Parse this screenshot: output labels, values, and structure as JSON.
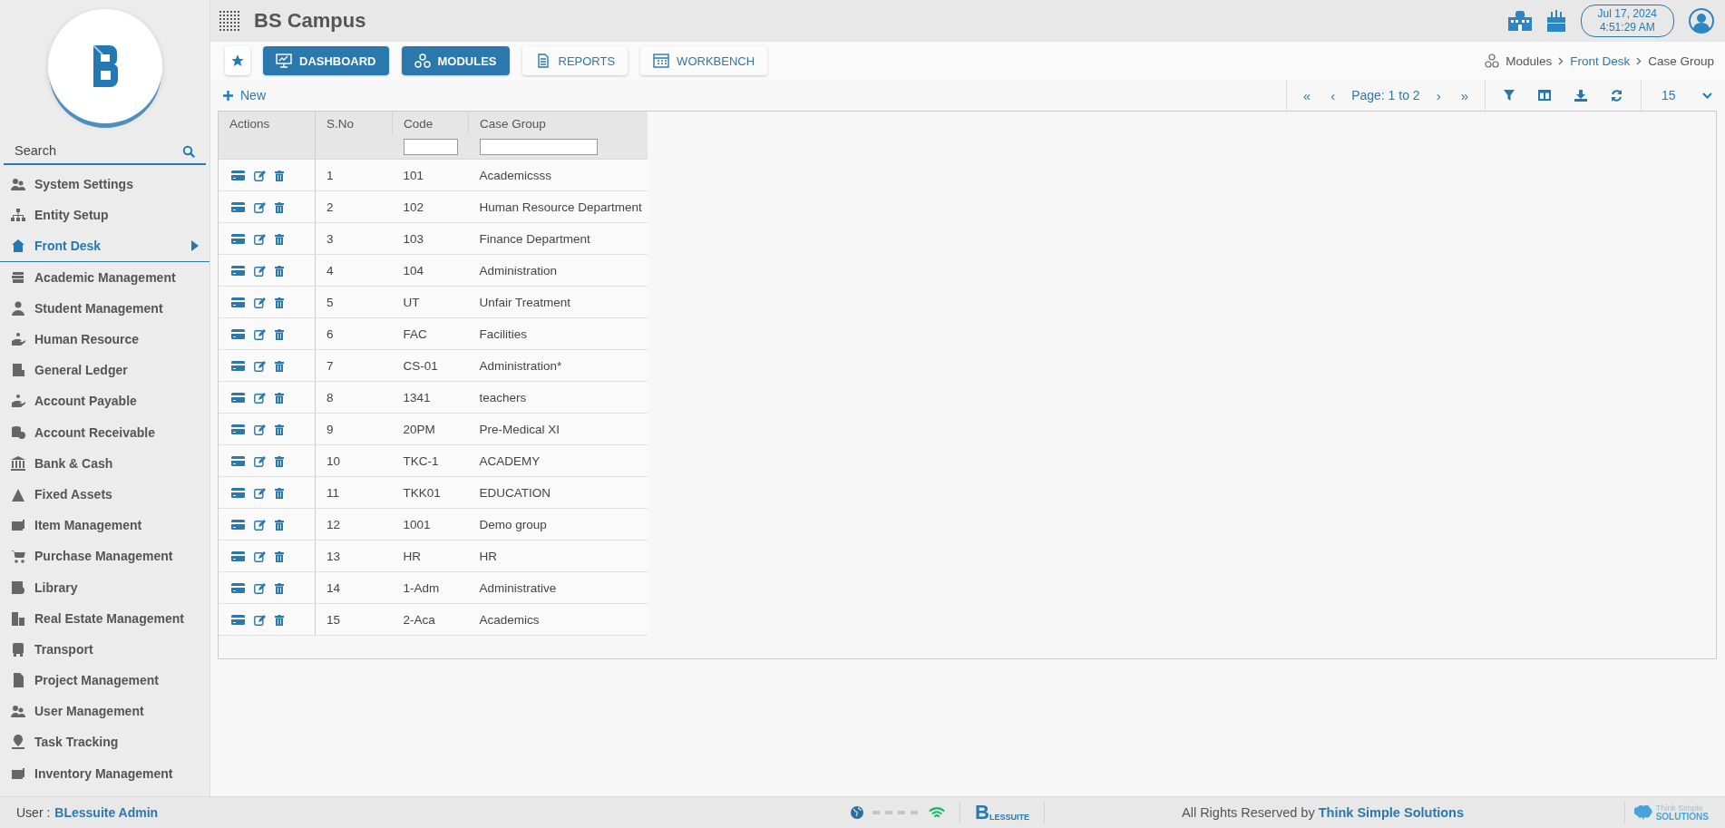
{
  "app": {
    "title": "BS Campus"
  },
  "header": {
    "date": "Jul 17, 2024",
    "time": "4:51:29 AM"
  },
  "sidebar": {
    "search": {
      "placeholder": "Search"
    },
    "items": [
      {
        "label": "System Settings",
        "selected": false
      },
      {
        "label": "Entity Setup",
        "selected": false
      },
      {
        "label": "Front Desk",
        "selected": true
      },
      {
        "label": "Academic Management",
        "selected": false
      },
      {
        "label": "Student Management",
        "selected": false
      },
      {
        "label": "Human Resource",
        "selected": false
      },
      {
        "label": "General Ledger",
        "selected": false
      },
      {
        "label": "Account Payable",
        "selected": false
      },
      {
        "label": "Account Receivable",
        "selected": false
      },
      {
        "label": "Bank & Cash",
        "selected": false
      },
      {
        "label": "Fixed Assets",
        "selected": false
      },
      {
        "label": "Item Management",
        "selected": false
      },
      {
        "label": "Purchase Management",
        "selected": false
      },
      {
        "label": "Library",
        "selected": false
      },
      {
        "label": "Real Estate Management",
        "selected": false
      },
      {
        "label": "Transport",
        "selected": false
      },
      {
        "label": "Project Management",
        "selected": false
      },
      {
        "label": "User Management",
        "selected": false
      },
      {
        "label": "Task Tracking",
        "selected": false
      },
      {
        "label": "Inventory Management",
        "selected": false
      }
    ]
  },
  "nav_buttons": [
    {
      "label": "DASHBOARD",
      "highlighted": true
    },
    {
      "label": "MODULES",
      "highlighted": true
    },
    {
      "label": "REPORTS",
      "highlighted": false
    },
    {
      "label": "WORKBENCH",
      "highlighted": false
    }
  ],
  "breadcrumb": [
    {
      "label": "Modules",
      "kind": "root"
    },
    {
      "label": "Front Desk",
      "kind": "link"
    },
    {
      "label": "Case Group",
      "kind": "current"
    }
  ],
  "new_button": "New",
  "pager": {
    "first": "«",
    "prev": "‹",
    "label": "Page: 1 to 2",
    "next": "›",
    "last": "»",
    "page_size": "15"
  },
  "table": {
    "columns": [
      "Actions",
      "S.No",
      "Code",
      "Case Group"
    ],
    "rows": [
      {
        "sno": "1",
        "code": "101",
        "case_group": "Academicsss"
      },
      {
        "sno": "2",
        "code": "102",
        "case_group": "Human Resource Department"
      },
      {
        "sno": "3",
        "code": "103",
        "case_group": "Finance Department"
      },
      {
        "sno": "4",
        "code": "104",
        "case_group": "Administration"
      },
      {
        "sno": "5",
        "code": "UT",
        "case_group": "Unfair Treatment"
      },
      {
        "sno": "6",
        "code": "FAC",
        "case_group": "Facilities"
      },
      {
        "sno": "7",
        "code": "CS-01",
        "case_group": "Administration*"
      },
      {
        "sno": "8",
        "code": "1341",
        "case_group": "teachers"
      },
      {
        "sno": "9",
        "code": "20PM",
        "case_group": "Pre-Medical XI"
      },
      {
        "sno": "10",
        "code": "TKC-1",
        "case_group": "ACADEMY"
      },
      {
        "sno": "11",
        "code": "TKK01",
        "case_group": "EDUCATION"
      },
      {
        "sno": "12",
        "code": "1001",
        "case_group": "Demo group"
      },
      {
        "sno": "13",
        "code": "HR",
        "case_group": "HR"
      },
      {
        "sno": "14",
        "code": "1-Adm",
        "case_group": "Administrative"
      },
      {
        "sno": "15",
        "code": "2-Aca",
        "case_group": "Academics"
      }
    ]
  },
  "footer": {
    "user_label": "User :",
    "user_name": "BLessuite Admin",
    "logo_mark": "B",
    "logo_text": "LESSUITE",
    "copyright": "All Rights Reserved by **Think Simple Solutions**",
    "brand_top": "Think Simple",
    "brand_bottom": "SOLUTIONS"
  }
}
